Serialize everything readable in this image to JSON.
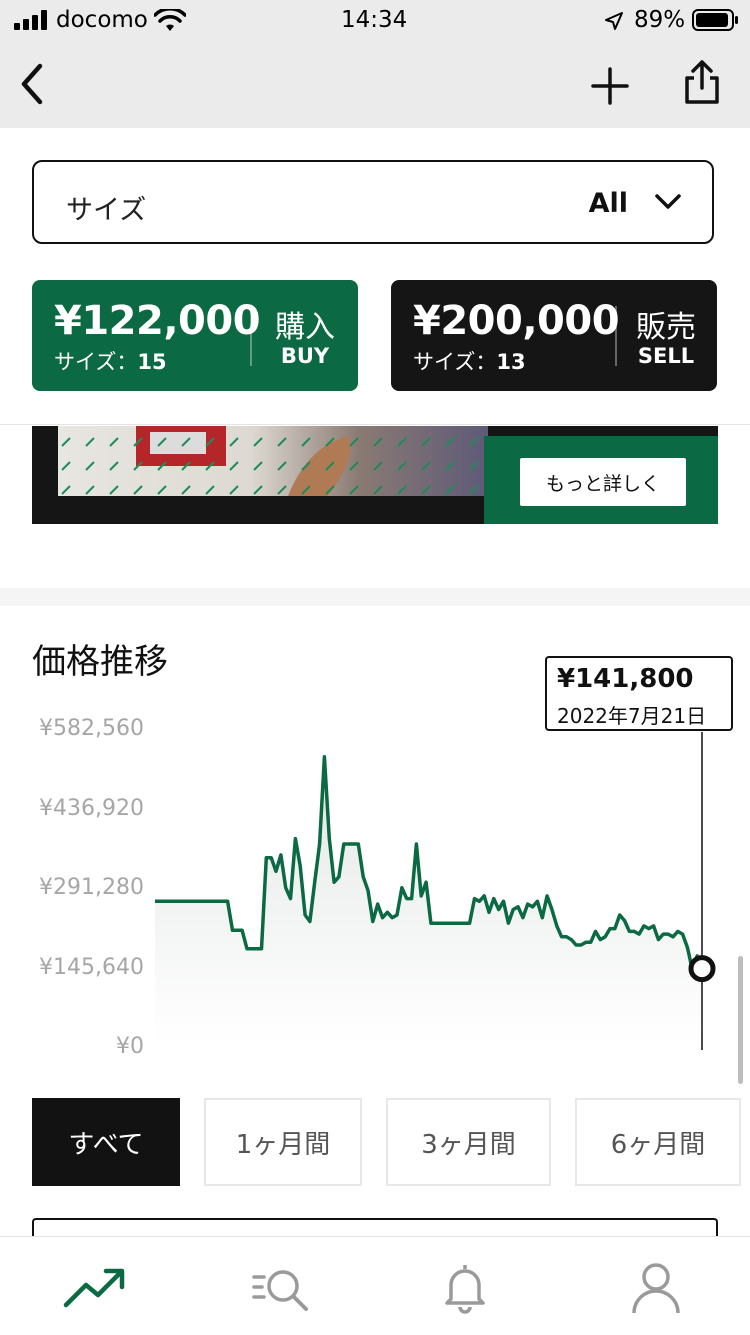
{
  "status_bar": {
    "carrier": "docomo",
    "time": "14:34",
    "battery": "89%"
  },
  "nav": {
    "back_icon": "chevron-left-icon",
    "add_icon": "plus-icon",
    "share_icon": "share-icon"
  },
  "size_filter": {
    "label": "サイズ",
    "value": "All"
  },
  "buy_card": {
    "price": "¥122,000",
    "size_label": "サイズ：",
    "size_value": "15",
    "action_jp": "購入",
    "action_en": "BUY",
    "color": "#0b6a43"
  },
  "sell_card": {
    "price": "¥200,000",
    "size_label": "サイズ：",
    "size_value": "13",
    "action_jp": "販売",
    "action_en": "SELL",
    "color": "#151515"
  },
  "banner": {
    "button_label": "もっと詳しく"
  },
  "price_history": {
    "title": "価格推移",
    "tooltip_price": "¥141,800",
    "tooltip_date": "2022年7月21日",
    "accent": "#0b6a43"
  },
  "chart_data": {
    "type": "line",
    "y_ticks": [
      "¥582,560",
      "¥436,920",
      "¥291,280",
      "¥145,640",
      "¥0"
    ],
    "ylim": [
      0,
      582560
    ],
    "series": [
      {
        "values": [
          265000,
          265000,
          265000,
          265000,
          265000,
          265000,
          265000,
          265000,
          265000,
          265000,
          265000,
          265000,
          265000,
          265000,
          265000,
          265000,
          212000,
          212000,
          212000,
          178000,
          178000,
          178000,
          178000,
          345000,
          345000,
          320000,
          350000,
          290000,
          270000,
          380000,
          330000,
          240000,
          228000,
          300000,
          370000,
          530000,
          380000,
          300000,
          310000,
          370000,
          370000,
          370000,
          370000,
          310000,
          285000,
          228000,
          260000,
          235000,
          245000,
          235000,
          240000,
          290000,
          270000,
          270000,
          370000,
          275000,
          300000,
          225000,
          225000,
          225000,
          225000,
          225000,
          225000,
          225000,
          225000,
          225000,
          270000,
          265000,
          275000,
          245000,
          270000,
          250000,
          265000,
          225000,
          250000,
          255000,
          235000,
          260000,
          255000,
          265000,
          235000,
          275000,
          250000,
          220000,
          200000,
          200000,
          195000,
          185000,
          185000,
          190000,
          190000,
          210000,
          195000,
          200000,
          215000,
          215000,
          240000,
          230000,
          210000,
          210000,
          205000,
          220000,
          215000,
          220000,
          195000,
          205000,
          205000,
          200000,
          210000,
          205000,
          180000,
          140000,
          165000,
          141800
        ]
      }
    ],
    "selected_point": {
      "date": "2022年7月21日",
      "value": 141800
    }
  },
  "period_tabs": [
    {
      "label": "すべて",
      "active": true
    },
    {
      "label": "1ヶ月間",
      "active": false
    },
    {
      "label": "3ヶ月間",
      "active": false
    },
    {
      "label": "6ヶ月間",
      "active": false
    }
  ],
  "bottom_nav": [
    {
      "icon": "trending-icon",
      "active": true
    },
    {
      "icon": "search-list-icon",
      "active": false
    },
    {
      "icon": "bell-icon",
      "active": false
    },
    {
      "icon": "person-icon",
      "active": false
    }
  ]
}
